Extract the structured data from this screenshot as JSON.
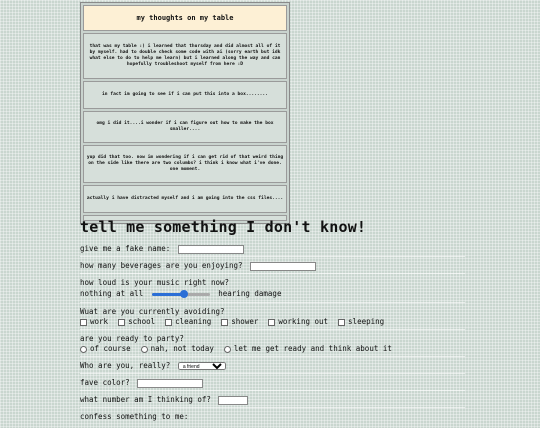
{
  "table": {
    "title": "my thoughts on my table",
    "rows": [
      "that was my table :) i learned that thursday and did almost all of it by myself. had to double check some code with ai (sorry earth but idk what else to do to help me learn) but i learned along the way and can hopefully troubleshoot myself from here :D",
      "in fact im going to see if i can put this into a box........",
      "omg i did it....i wonder if i can figure out how to make the box smaller....",
      "yup did that too. now im wondering if i can get rid of that weird thing on the side like there are two columbs? i think i know what i've done. one moment.",
      "actually i have distracted myself and i am going into the css files....",
      ""
    ]
  },
  "form": {
    "heading": "tell me something I don't know!",
    "fake_name_label": "give me a fake name:",
    "beverages_label": "how many beverages are you enjoying?",
    "music_label": "how loud is your music right now?",
    "music_min": "nothing at all",
    "music_max": "hearing damage",
    "music_level": 0.55,
    "avoiding_label": "Wuat are you currently avoiding?",
    "avoiding_options": [
      "work",
      "school",
      "cleaning",
      "shower",
      "working out",
      "sleeping"
    ],
    "party_label": "are you ready to party?",
    "party_options": [
      "of course",
      "nah, not today",
      "let me get ready and think about it"
    ],
    "who_label": "Who are you, really?",
    "who_selected": "a friend",
    "color_label": "fave color?",
    "number_label": "what number am I thinking of?",
    "confess_label": "confess something to me:"
  }
}
